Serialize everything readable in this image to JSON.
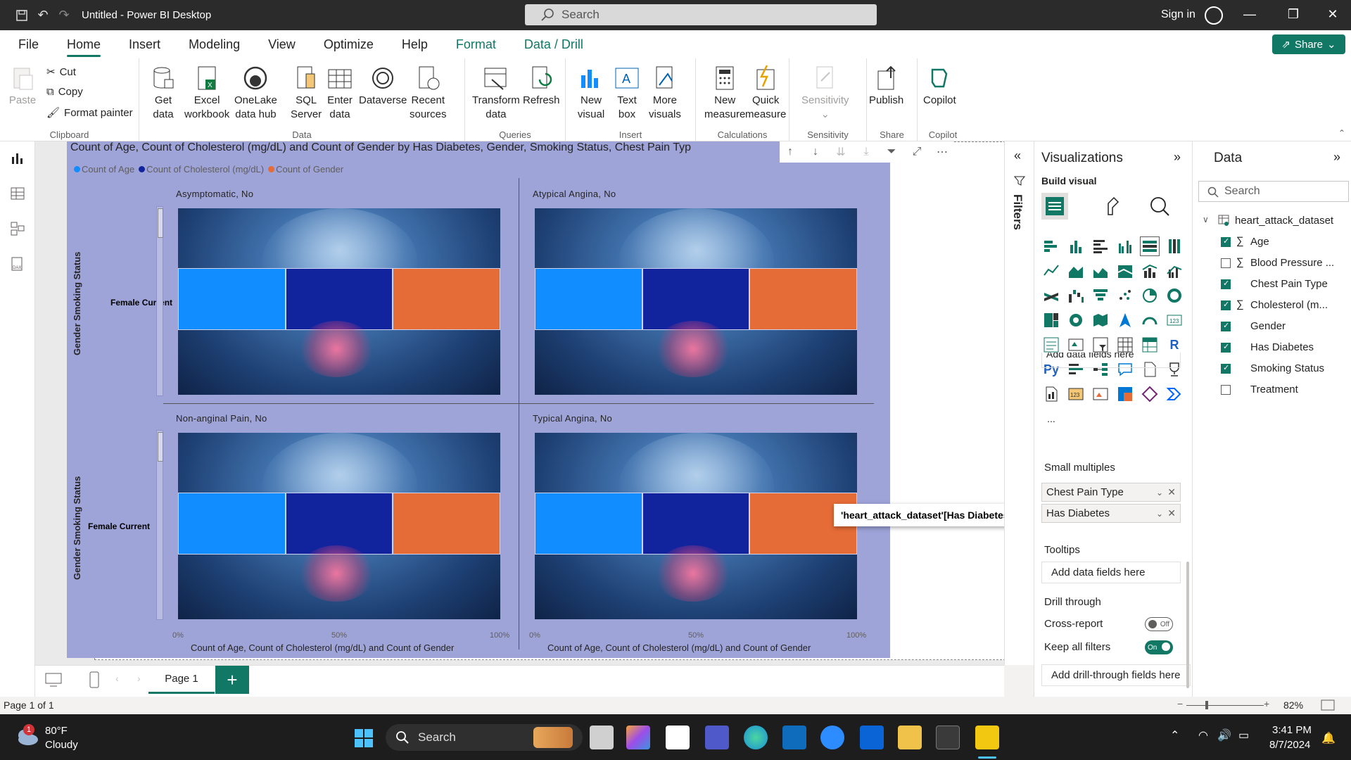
{
  "window": {
    "title": "Untitled - Power BI Desktop",
    "search_placeholder": "Search",
    "signin": "Sign in"
  },
  "menu": {
    "tabs": [
      "File",
      "Home",
      "Insert",
      "Modeling",
      "View",
      "Optimize",
      "Help",
      "Format",
      "Data / Drill"
    ],
    "share": "Share"
  },
  "ribbon": {
    "clipboard": {
      "paste": "Paste",
      "cut": "Cut",
      "copy": "Copy",
      "format_painter": "Format painter",
      "label": "Clipboard"
    },
    "data": {
      "get_data": [
        "Get",
        "data"
      ],
      "excel": [
        "Excel",
        "workbook"
      ],
      "onelake": [
        "OneLake",
        "data hub"
      ],
      "sql": [
        "SQL",
        "Server"
      ],
      "enter": [
        "Enter",
        "data"
      ],
      "dataverse": "Dataverse",
      "recent": [
        "Recent",
        "sources"
      ],
      "label": "Data"
    },
    "queries": {
      "transform": [
        "Transform",
        "data"
      ],
      "refresh": "Refresh",
      "label": "Queries"
    },
    "insert": {
      "new_visual": [
        "New",
        "visual"
      ],
      "text_box": [
        "Text",
        "box"
      ],
      "more_visuals": [
        "More",
        "visuals"
      ],
      "label": "Insert"
    },
    "calculations": {
      "new_measure": [
        "New",
        "measure"
      ],
      "quick_measure": [
        "Quick",
        "measure"
      ],
      "label": "Calculations"
    },
    "sensitivity": {
      "btn": "Sensitivity",
      "label": "Sensitivity"
    },
    "share": {
      "publish": "Publish",
      "label": "Share"
    },
    "copilot": {
      "btn": "Copilot",
      "label": "Copilot"
    }
  },
  "visual": {
    "title": "Count of Age, Count of Cholesterol (mg/dL) and Count of Gender by Has Diabetes, Gender, Smoking Status, Chest Pain Typ",
    "title_tail": "a",
    "title_tail2": "es",
    "legend": [
      {
        "label": "Count of Age",
        "color": "#118dff"
      },
      {
        "label": "Count of Cholesterol (mg/dL)",
        "color": "#12239e"
      },
      {
        "label": "Count of Gender",
        "color": "#e66c37"
      }
    ],
    "y_axis_title": "Gender Smoking Status",
    "row_label": "Female Current",
    "x_axis_title": "Count of Age, Count of Cholesterol (mg/dL) and Count of Gender",
    "ticks": [
      "0%",
      "50%",
      "100%"
    ],
    "panels": [
      {
        "title": "Asymptomatic, No"
      },
      {
        "title": "Atypical Angina, No"
      },
      {
        "title": "Non-anginal Pain, No"
      },
      {
        "title": "Typical Angina, No"
      }
    ]
  },
  "tooltip": "'heart_attack_dataset'[Has Diabetes]",
  "pages": {
    "tab": "Page 1",
    "add": "+"
  },
  "status": {
    "page_count": "Page 1 of 1",
    "zoom": "82%"
  },
  "filters_label": "Filters",
  "viz_pane": {
    "title": "Visualizations",
    "build": "Build visual",
    "ellipsis": "...",
    "partial_field": "Add data fields here",
    "small_multiples": "Small multiples",
    "sm_fields": [
      "Chest Pain Type",
      "Has Diabetes"
    ],
    "tooltips": "Tooltips",
    "tooltips_add": "Add data fields here",
    "drill_through": "Drill through",
    "cross_report": "Cross-report",
    "cross_report_state": "Off",
    "keep_filters": "Keep all filters",
    "keep_filters_state": "On",
    "drill_add": "Add drill-through fields here"
  },
  "data_pane": {
    "title": "Data",
    "search": "Search",
    "table": "heart_attack_dataset",
    "fields": [
      {
        "name": "Age",
        "checked": true,
        "sigma": true
      },
      {
        "name": "Blood Pressure ...",
        "checked": false,
        "sigma": true
      },
      {
        "name": "Chest Pain Type",
        "checked": true,
        "sigma": false
      },
      {
        "name": "Cholesterol (m...",
        "checked": true,
        "sigma": true
      },
      {
        "name": "Gender",
        "checked": true,
        "sigma": false
      },
      {
        "name": "Has Diabetes",
        "checked": true,
        "sigma": false
      },
      {
        "name": "Smoking Status",
        "checked": true,
        "sigma": false
      },
      {
        "name": "Treatment",
        "checked": false,
        "sigma": false
      }
    ]
  },
  "taskbar": {
    "temp": "80°F",
    "weather": "Cloudy",
    "badge": "1",
    "search": "Search",
    "time": "3:41 PM",
    "date": "8/7/2024"
  }
}
